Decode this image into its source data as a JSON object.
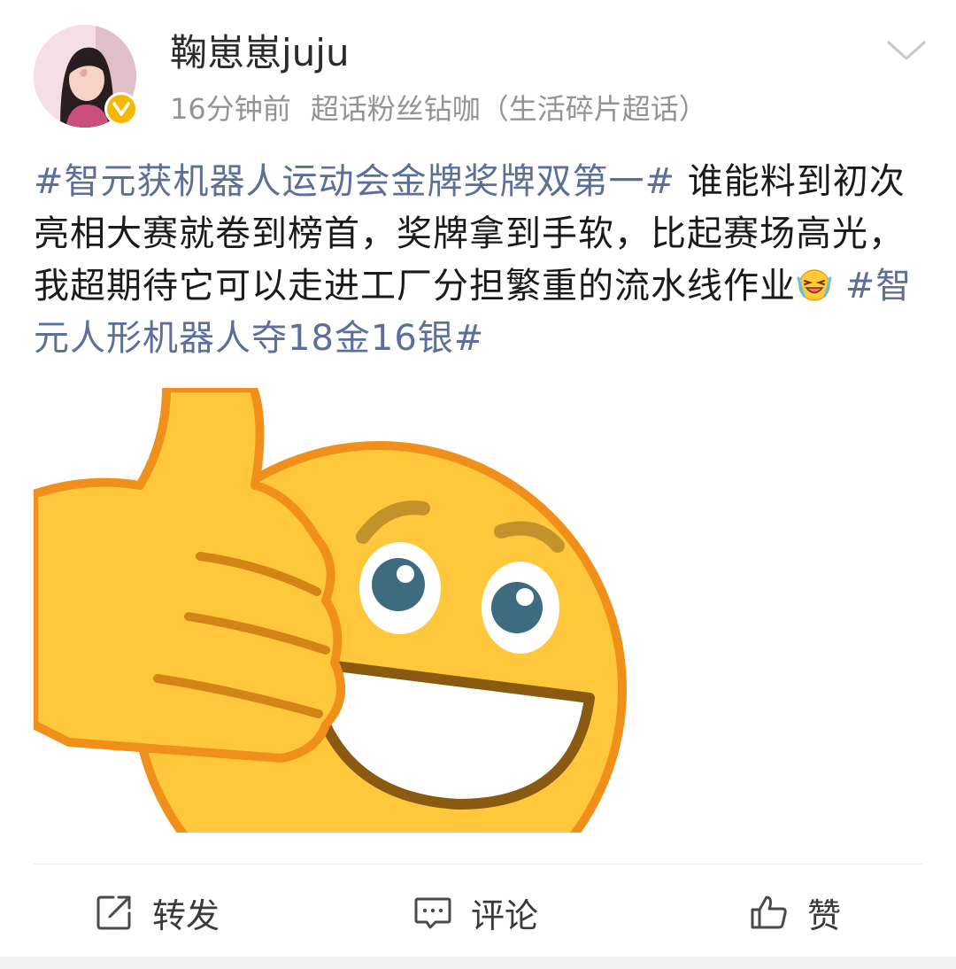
{
  "post": {
    "username": "鞠崽崽juju",
    "time": "16分钟前",
    "source": "超话粉丝钻咖（生活碎片超话）",
    "content": {
      "hashtag1": "#智元获机器人运动会金牌奖牌双第一#",
      "text": " 谁能料到初次亮相大赛就卷到榜首，奖牌拿到手软，比起赛场高光，我超期待它可以走进工厂分担繁重的流水线作业",
      "hashtag2": "#智元人形机器人夺18金16银#"
    }
  },
  "icons": {
    "verified": "verified-badge-icon",
    "more": "chevron-down-icon",
    "inline_emoji": "laughing-crying-emoji-icon",
    "image": "thumbs-up-smiley-image",
    "repost": "repost-icon",
    "comment": "comment-icon",
    "like": "thumbs-up-icon"
  },
  "actions": {
    "repost_label": "转发",
    "comment_label": "评论",
    "like_label": "赞"
  },
  "colors": {
    "hashtag": "#5b6f99",
    "verified": "#f5b800",
    "meta_text": "#939393"
  }
}
